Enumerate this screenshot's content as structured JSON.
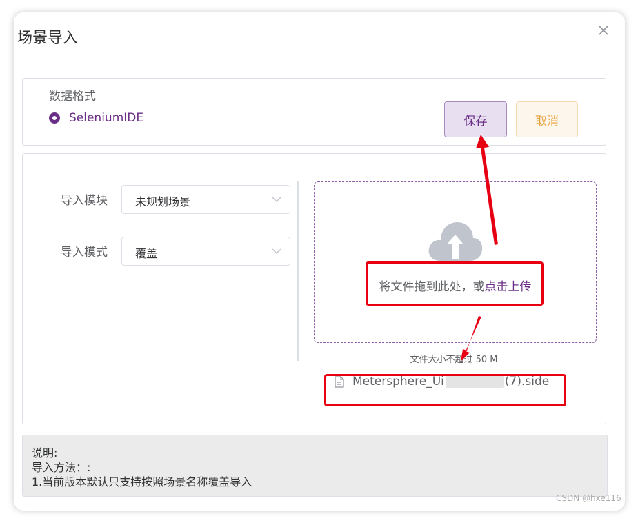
{
  "dialog": {
    "title": "场景导入"
  },
  "format": {
    "label": "数据格式",
    "option": "SeleniumIDE"
  },
  "buttons": {
    "save": "保存",
    "cancel": "取消"
  },
  "form": {
    "module_label": "导入模块",
    "module_value": "未规划场景",
    "mode_label": "导入模式",
    "mode_value": "覆盖"
  },
  "upload": {
    "drag_text": "将文件拖到此处，或",
    "click_text": "点击上传",
    "tip": "文件大小不超过 50 M",
    "file_prefix": "Metersphere_Ui",
    "file_suffix": "(7).side"
  },
  "note": {
    "line1": "说明:",
    "line2": "导入方法：:",
    "line3": "1.当前版本默认只支持按照场景名称覆盖导入"
  },
  "watermark": "CSDN @hxe116",
  "colors": {
    "primary": "#6b2e86",
    "warning": "#e6a23c",
    "annotation": "#e60012"
  },
  "icons": {
    "close": "close-icon",
    "dropdown": "chevron-down-icon",
    "upload": "upload-cloud-icon",
    "file": "document-icon"
  }
}
